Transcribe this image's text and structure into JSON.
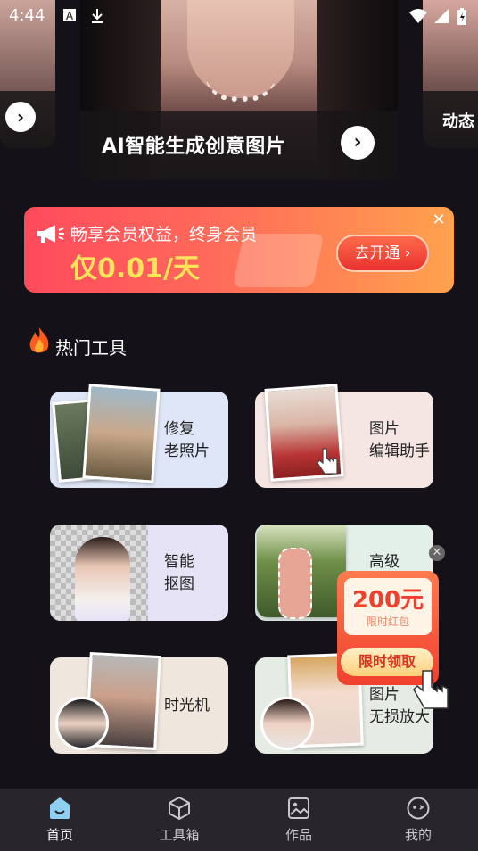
{
  "status": {
    "time": "4:44"
  },
  "carousel": {
    "center_title": "AI智能生成创意图片",
    "right_label": "动态",
    "next_arrow": "›"
  },
  "promo": {
    "subtitle": "畅享会员权益，终身会员",
    "price_text": "仅0.01/天",
    "cta": "去开通",
    "cta_arrow": "›",
    "close": "✕"
  },
  "section": {
    "title": "热门工具"
  },
  "tools": [
    {
      "label": "修复\n老照片"
    },
    {
      "label": "图片\n编辑助手"
    },
    {
      "label": "智能\n抠图"
    },
    {
      "label": "高级"
    },
    {
      "label": "时光机"
    },
    {
      "label": "图片\n无损放大"
    }
  ],
  "redpacket": {
    "amount": "200元",
    "subtitle": "限时红包",
    "cta": "限时领取",
    "close": "✕"
  },
  "tabs": [
    {
      "label": "首页",
      "active": true
    },
    {
      "label": "工具箱",
      "active": false
    },
    {
      "label": "作品",
      "active": false
    },
    {
      "label": "我的",
      "active": false
    }
  ],
  "colors": {
    "background": "#141218",
    "promo_gradient_start": "#ff4a5c",
    "promo_gradient_end": "#ffa24d",
    "promo_price": "#ffe35a",
    "tabbar": "#28262c",
    "home_icon": "#8fd0f2"
  }
}
